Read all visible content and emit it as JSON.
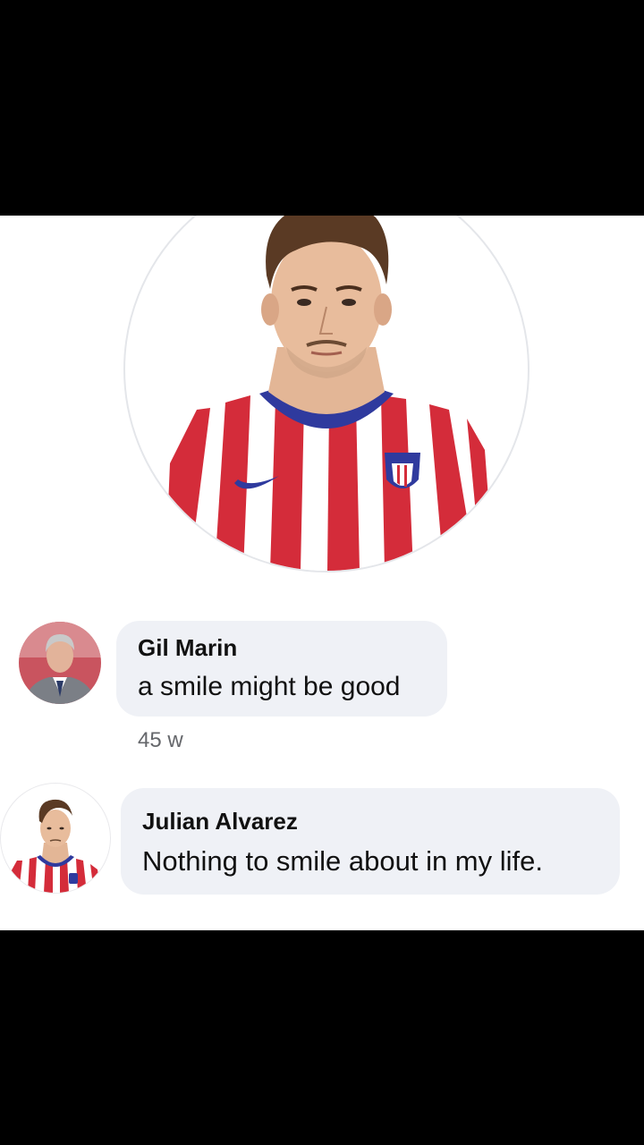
{
  "profile": {
    "photo_icon": "player-portrait-image",
    "jersey_colors": {
      "red": "#d42c3a",
      "white": "#ffffff",
      "collar": "#2f3a9e"
    }
  },
  "comments": [
    {
      "author": "Gil Marin",
      "text": "a smile might be good",
      "time": "45 w",
      "avatar_icon": "man-in-suit-avatar"
    },
    {
      "author": "Julian Alvarez",
      "text": "Nothing to smile about in my life.",
      "avatar_icon": "player-avatar"
    }
  ],
  "colors": {
    "bubble_bg": "#eff1f6",
    "meta_text": "#65676b",
    "body_text": "#111111",
    "letterbox": "#000000"
  }
}
